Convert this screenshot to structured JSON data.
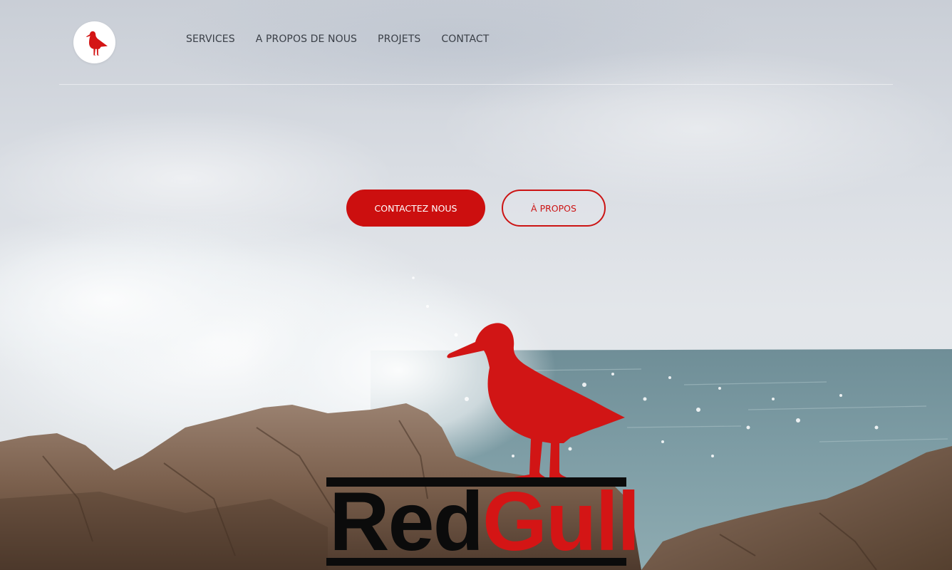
{
  "header": {
    "logo_alt": "RedGull",
    "nav": [
      {
        "label": "SERVICES"
      },
      {
        "label": "A PROPOS DE NOUS"
      },
      {
        "label": "PROJETS"
      },
      {
        "label": "CONTACT"
      }
    ]
  },
  "hero": {
    "primary_button": "CONTACTEZ NOUS",
    "secondary_button": "À PROPOS"
  },
  "brand": {
    "word_black": "Red",
    "word_red": "Gull"
  },
  "colors": {
    "accent_red": "#cc0f0f",
    "nav_text": "#3a3f47",
    "wordmark_black": "#0b0b0b"
  },
  "icons": {
    "logo": "seagull-icon",
    "hero_mascot": "seagull-icon"
  }
}
